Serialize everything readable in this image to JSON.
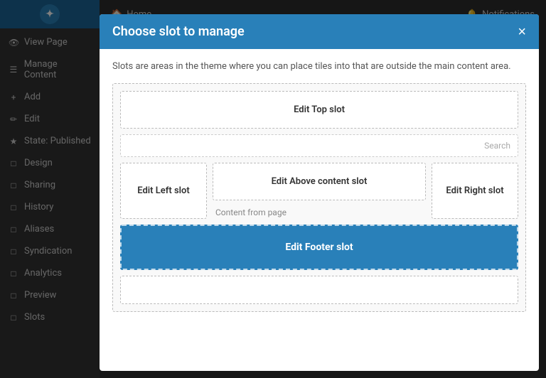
{
  "topbar": {
    "home_label": "Home",
    "notifications_label": "Notifications"
  },
  "logo": {
    "icon_char": "✦"
  },
  "sidebar": {
    "items": [
      {
        "id": "view-page",
        "label": "View Page",
        "icon": "👁"
      },
      {
        "id": "manage-content",
        "label": "Manage Content",
        "icon": "☰"
      },
      {
        "id": "add",
        "label": "Add",
        "icon": "+"
      },
      {
        "id": "edit",
        "label": "Edit",
        "icon": "✏"
      },
      {
        "id": "state-published",
        "label": "State: Published",
        "icon": "★"
      },
      {
        "id": "design",
        "label": "Design",
        "icon": "□"
      },
      {
        "id": "sharing",
        "label": "Sharing",
        "icon": "□"
      },
      {
        "id": "history",
        "label": "History",
        "icon": "□"
      },
      {
        "id": "aliases",
        "label": "Aliases",
        "icon": "□"
      },
      {
        "id": "syndication",
        "label": "Syndication",
        "icon": "□"
      },
      {
        "id": "analytics",
        "label": "Analytics",
        "icon": "□"
      },
      {
        "id": "preview",
        "label": "Preview",
        "icon": "□"
      },
      {
        "id": "slots",
        "label": "Slots",
        "icon": "□"
      }
    ]
  },
  "modal": {
    "title": "Choose slot to manage",
    "close_label": "×",
    "description": "Slots are areas in the theme where you can place tiles into that are outside the main content area.",
    "slots": {
      "top_label": "Edit Top slot",
      "search_placeholder": "Search",
      "left_label": "Edit Left slot",
      "above_label": "Edit Above content slot",
      "content_from_page": "Content from page",
      "right_label": "Edit Right slot",
      "footer_label": "Edit Footer slot"
    }
  }
}
